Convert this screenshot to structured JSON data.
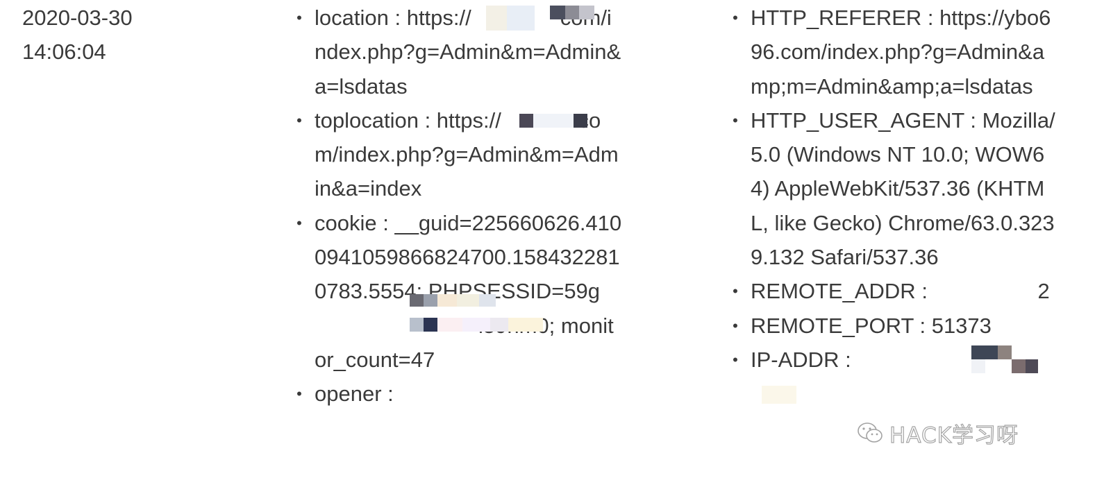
{
  "log_entry": {
    "timestamp": {
      "date": "2020-03-30",
      "time": "14:06:04"
    },
    "request_fields": [
      {
        "key": "location",
        "value": "https://",
        "value_tail": "co​m/index.php?g=Admin&m=Admin&a=lsdatas"
      },
      {
        "key": "toplocation",
        "value": "https://",
        "value_tail": ".com/index.php?g=Admin&m=Admin&a=index"
      },
      {
        "key": "cookie",
        "value": "__guid=225660626.4100941059866824700.1584322810783.5554; PHPSESSID=59g",
        "value_tail": "l59hm0; monitor_count=47"
      },
      {
        "key": "opener",
        "value": ""
      }
    ],
    "server_fields": [
      {
        "key": "HTTP_REFERER",
        "value": "https://ybo696.com/index.php?g=Admin&amp;m=Admin&amp;a=lsdatas"
      },
      {
        "key": "HTTP_USER_AGENT",
        "value": "Mozilla/5.0 (Windows NT 10.0; WOW64) AppleWebKit/537.36 (KHTML, like Gecko) Chrome/63.0.3239.132 Safari/537.36"
      },
      {
        "key": "REMOTE_ADDR",
        "value": "",
        "value_tail": "2"
      },
      {
        "key": "REMOTE_PORT",
        "value": "51373"
      },
      {
        "key": "IP-ADDR",
        "value": ""
      }
    ],
    "separator": " : ",
    "bullet": "•"
  },
  "watermark": {
    "text": "HACK学习呀",
    "icon": "wechat-logo-icon"
  },
  "colors": {
    "text": "#3a3a3a",
    "background": "#ffffff"
  }
}
